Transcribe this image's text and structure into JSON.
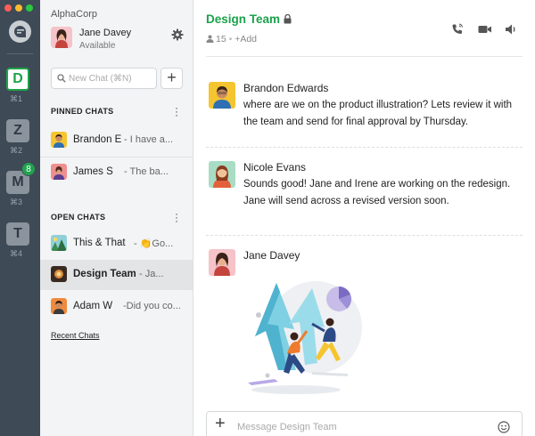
{
  "window": {
    "traffic_lights": {
      "close": "#ff5f57",
      "minimize": "#febc2e",
      "zoom": "#28c840"
    }
  },
  "rail": {
    "logo_icon": "flock-logo-icon",
    "workspaces": [
      {
        "letter": "D",
        "shortcut": "⌘1",
        "active": true,
        "badge": ""
      },
      {
        "letter": "Z",
        "shortcut": "⌘2",
        "active": false,
        "badge": ""
      },
      {
        "letter": "M",
        "shortcut": "⌘3",
        "active": false,
        "badge": "8"
      },
      {
        "letter": "T",
        "shortcut": "⌘4",
        "active": false,
        "badge": ""
      }
    ]
  },
  "sidebar": {
    "org_name": "AlphaCorp",
    "user": {
      "name": "Jane Davey",
      "status": "Available"
    },
    "new_chat": {
      "placeholder": "New Chat (⌘N)",
      "value": ""
    },
    "add_label": "+",
    "pinned_title": "PINNED CHATS",
    "pinned": [
      {
        "name": "Brandon E",
        "preview": "- I have a..."
      },
      {
        "name": "James S",
        "preview": "- The ba..."
      }
    ],
    "open_title": "OPEN CHATS",
    "open": [
      {
        "name": "This & That",
        "preview": "- 👏Go..."
      },
      {
        "name": "Design Team",
        "preview": "- Ja..."
      },
      {
        "name": "Adam W",
        "preview": "-Did you co..."
      }
    ],
    "recent_link": "Recent Chats"
  },
  "channel": {
    "title": "Design Team",
    "member_count": "15",
    "add_label": "+Add"
  },
  "messages": [
    {
      "author": "Brandon Edwards",
      "text": "where are we on the product illustration? Lets review it with the team and send for final approval by Thursday."
    },
    {
      "author": "Nicole Evans",
      "text": "Sounds good! Jane and Irene are working on the redesign. Jane will send across a revised version soon."
    },
    {
      "author": "Jane Davey",
      "text": ""
    }
  ],
  "composer": {
    "placeholder": "Message Design Team",
    "value": ""
  },
  "colors": {
    "accent": "#1aa24b",
    "rail_bg": "#3e4a56",
    "sidebar_bg": "#f3f4f5",
    "selected_row": "#e2e4e6"
  },
  "icons": [
    "search-icon",
    "gear-icon",
    "lock-icon",
    "person-icon",
    "phone-icon",
    "video-icon",
    "speaker-icon",
    "emoji-icon",
    "kebab-icon"
  ]
}
